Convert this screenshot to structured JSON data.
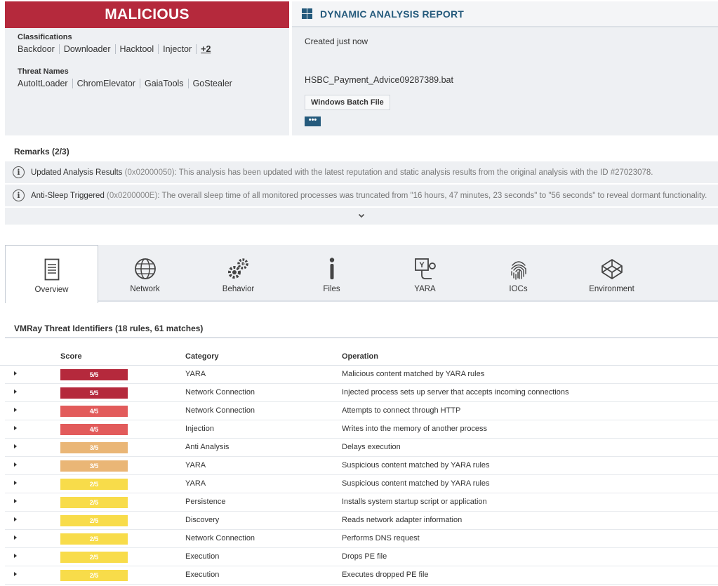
{
  "verdict": "MALICIOUS",
  "classifications": {
    "label": "Classifications",
    "items": [
      "Backdoor",
      "Downloader",
      "Hacktool",
      "Injector"
    ],
    "more": "+2"
  },
  "threat_names": {
    "label": "Threat Names",
    "items": [
      "AutoItLoader",
      "ChromElevator",
      "GaiaTools",
      "GoStealer"
    ]
  },
  "report": {
    "title": "DYNAMIC ANALYSIS REPORT",
    "created": "Created just now",
    "filename": "HSBC_Payment_Advice09287389.bat",
    "filetype": "Windows Batch File",
    "more_label": "•••"
  },
  "remarks": {
    "title": "Remarks (2/3)",
    "items": [
      {
        "name": "Updated Analysis Results",
        "code": "(0x02000050)",
        "text": ": This analysis has been updated with the latest reputation and static analysis results from the original analysis with the ID #27023078."
      },
      {
        "name": "Anti-Sleep Triggered",
        "code": "(0x0200000E)",
        "text": ": The overall sleep time of all monitored processes was truncated from \"16 hours, 47 minutes, 23 seconds\" to \"56 seconds\" to reveal dormant functionality."
      }
    ],
    "expand_icon": "chevron-down-icon"
  },
  "tabs": [
    {
      "label": "Overview",
      "icon": "document-icon",
      "active": true
    },
    {
      "label": "Network",
      "icon": "globe-icon"
    },
    {
      "label": "Behavior",
      "icon": "gears-icon"
    },
    {
      "label": "Files",
      "icon": "info-icon"
    },
    {
      "label": "YARA",
      "icon": "yara-icon"
    },
    {
      "label": "IOCs",
      "icon": "fingerprint-icon"
    },
    {
      "label": "Environment",
      "icon": "codepen-icon"
    }
  ],
  "vti": {
    "title": "VMRay Threat Identifiers (18 rules, 61 matches)",
    "headers": {
      "score": "Score",
      "category": "Category",
      "operation": "Operation"
    },
    "colors": {
      "5/5": "#b5293c",
      "4/5": "#e25b5b",
      "3/5": "#eab676",
      "2/5": "#f8dc4a"
    },
    "rows": [
      {
        "score": "5/5",
        "category": "YARA",
        "operation": "Malicious content matched by YARA rules"
      },
      {
        "score": "5/5",
        "category": "Network Connection",
        "operation": "Injected process sets up server that accepts incoming connections"
      },
      {
        "score": "4/5",
        "category": "Network Connection",
        "operation": "Attempts to connect through HTTP"
      },
      {
        "score": "4/5",
        "category": "Injection",
        "operation": "Writes into the memory of another process"
      },
      {
        "score": "3/5",
        "category": "Anti Analysis",
        "operation": "Delays execution"
      },
      {
        "score": "3/5",
        "category": "YARA",
        "operation": "Suspicious content matched by YARA rules"
      },
      {
        "score": "2/5",
        "category": "YARA",
        "operation": "Suspicious content matched by YARA rules"
      },
      {
        "score": "2/5",
        "category": "Persistence",
        "operation": "Installs system startup script or application"
      },
      {
        "score": "2/5",
        "category": "Discovery",
        "operation": "Reads network adapter information"
      },
      {
        "score": "2/5",
        "category": "Network Connection",
        "operation": "Performs DNS request"
      },
      {
        "score": "2/5",
        "category": "Execution",
        "operation": "Drops PE file"
      },
      {
        "score": "2/5",
        "category": "Execution",
        "operation": "Executes dropped PE file"
      }
    ]
  }
}
